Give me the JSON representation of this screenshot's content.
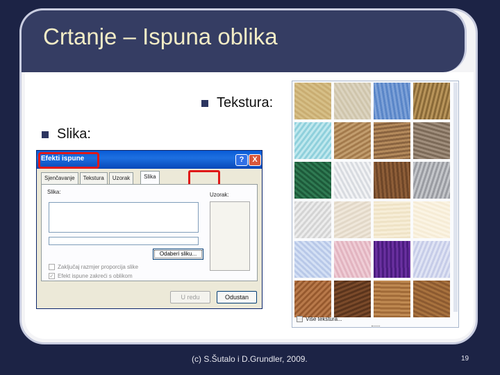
{
  "slide": {
    "title": "Crtanje – Ispuna oblika",
    "bullets": {
      "tekstura": "Tekstura:",
      "slika": "Slika:"
    },
    "footer": "(c) S.Šutalo i D.Grundler, 2009.",
    "page_number": "19"
  },
  "dialog": {
    "title": "Efekti ispune",
    "help_symbol": "?",
    "close_symbol": "X",
    "tabs": [
      "Sjenčavanje",
      "Tekstura",
      "Uzorak",
      "Slika"
    ],
    "active_tab": "Slika",
    "picture_label": "Slika:",
    "sample_label": "Uzorak:",
    "select_picture_button": "Odaberi sliku...",
    "checkboxes": [
      {
        "label": "Zaključaj razmjer proporcija slike",
        "checked": false
      },
      {
        "label": "Efekt ispune zakreći s oblikom",
        "checked": true
      }
    ],
    "ok_button": "U redu",
    "close_button": "Odustan",
    "highlight_color": "#e01818"
  },
  "gallery": {
    "more_textures": "Više tekstura...",
    "textures": [
      {
        "name": "papirus",
        "c1": "#d6bf87",
        "c2": "#c9ad72"
      },
      {
        "name": "platno",
        "c1": "#dcd4c0",
        "c2": "#cfc5ac"
      },
      {
        "name": "traperica",
        "c1": "#5a86c8",
        "c2": "#7ea2d8"
      },
      {
        "name": "tkana prostirka",
        "c1": "#b8945a",
        "c2": "#8a6a38"
      },
      {
        "name": "kapljice vode",
        "c1": "#8fd0dc",
        "c2": "#c0e8ee"
      },
      {
        "name": "papirnata vrećica",
        "c1": "#a37a4c",
        "c2": "#c29d6e"
      },
      {
        "name": "fosil",
        "c1": "#b48a5c",
        "c2": "#8a6440"
      },
      {
        "name": "pijesak",
        "c1": "#a08e7c",
        "c2": "#7c6a58"
      },
      {
        "name": "zeleni mramor",
        "c1": "#1d5a3a",
        "c2": "#2f7a52"
      },
      {
        "name": "bijeli mramor",
        "c1": "#d8dbe0",
        "c2": "#f2f3f5"
      },
      {
        "name": "smeđi mramor",
        "c1": "#6e4628",
        "c2": "#8e5e38"
      },
      {
        "name": "granit",
        "c1": "#9a9ca2",
        "c2": "#c4c6ca"
      },
      {
        "name": "novinski papir",
        "c1": "#d4d4d4",
        "c2": "#ececec"
      },
      {
        "name": "reciklirani papir",
        "c1": "#e2d8c8",
        "c2": "#efe7da"
      },
      {
        "name": "pergament",
        "c1": "#efe3c6",
        "c2": "#f7eed8"
      },
      {
        "name": "papir za pisanje",
        "c1": "#f6ecd6",
        "c2": "#fbf4e4"
      },
      {
        "name": "plavi papir",
        "c1": "#b8c8e8",
        "c2": "#d4e0f4"
      },
      {
        "name": "ružičasti papir",
        "c1": "#e2b4c0",
        "c2": "#efcdd6"
      },
      {
        "name": "ljubičasta mreža",
        "c1": "#4a1c7e",
        "c2": "#6a30a0"
      },
      {
        "name": "buket",
        "c1": "#c6cce8",
        "c2": "#e0e4f4"
      },
      {
        "name": "pluto",
        "c1": "#b8794a",
        "c2": "#96592e"
      },
      {
        "name": "orah",
        "c1": "#5a341c",
        "c2": "#7a4a2a"
      },
      {
        "name": "hrast",
        "c1": "#c08a52",
        "c2": "#a06a38"
      },
      {
        "name": "srednje drvo",
        "c1": "#8c5a30",
        "c2": "#a8723e"
      }
    ]
  }
}
